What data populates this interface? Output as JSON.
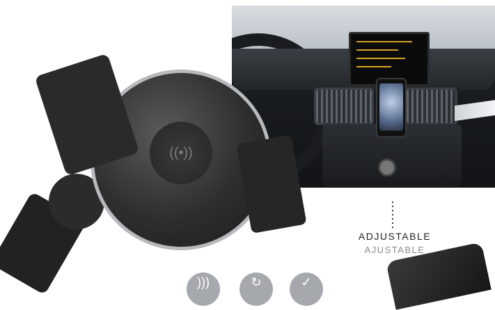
{
  "label": {
    "english": "ADJUSTABLE",
    "french": "AJUSTABLE"
  },
  "icons": [
    "wireless-icon",
    "rotate-icon",
    "check-icon"
  ],
  "colors": {
    "label_primary": "#222222",
    "label_secondary": "#8a8a8a",
    "feature_icon_bg": "#a5a9ae"
  }
}
